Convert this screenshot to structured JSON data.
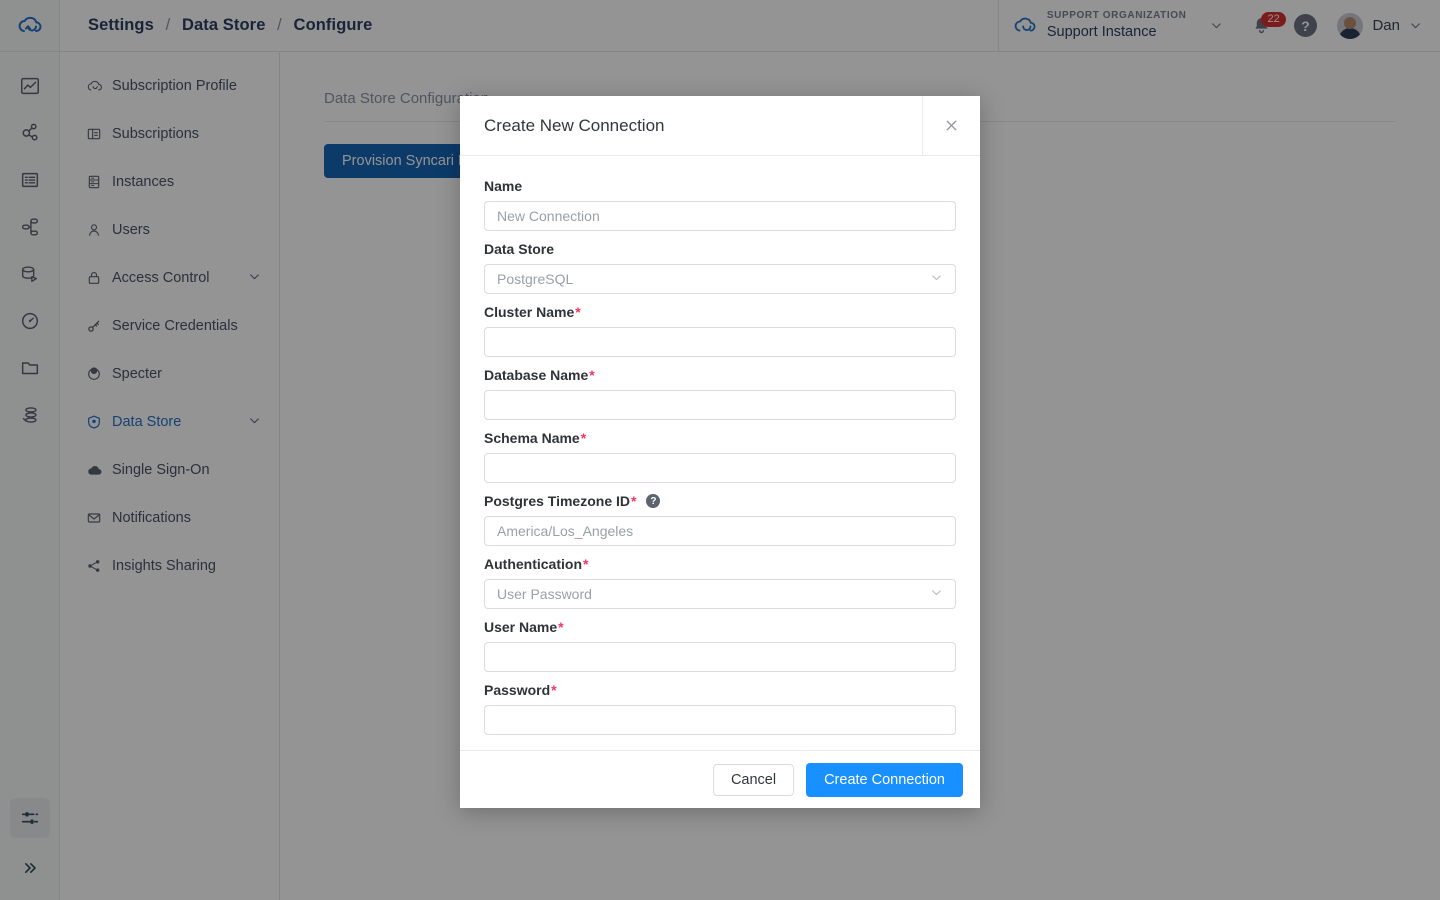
{
  "colors": {
    "brand_blue": "#2573c6",
    "primary_button": "#1890ff",
    "provision_button": "#1565b5",
    "required_asterisk": "#f5365c",
    "badge_red": "#d63031",
    "breadcrumb_text": "#2c3e63"
  },
  "topbar": {
    "logo_icon": "cloud-sync-logo",
    "breadcrumb": {
      "items": [
        "Settings",
        "Data Store",
        "Configure"
      ],
      "separator": "/"
    },
    "org": {
      "icon": "cloud-sync-icon",
      "label": "SUPPORT ORGANIZATION",
      "name": "Support Instance",
      "caret_icon": "chevron-down-icon"
    },
    "notifications": {
      "icon": "bell-icon",
      "count": "22"
    },
    "help": {
      "icon": "question-mark-icon",
      "glyph": "?"
    },
    "user": {
      "avatar_icon": "user-avatar",
      "name": "Dan",
      "caret_icon": "chevron-down-icon"
    }
  },
  "rail": {
    "icons": [
      "analytics-chart-icon",
      "nodes-graph-icon",
      "list-icon",
      "pipeline-icon",
      "database-sync-icon",
      "gauge-icon",
      "folder-icon",
      "data-stack-icon"
    ],
    "bottom": {
      "settings_icon": "sliders-settings-icon",
      "expand_icon": "chevron-double-right-icon"
    }
  },
  "sidebar": {
    "items": [
      {
        "label": "Subscription Profile",
        "icon": "cloud-icon",
        "active": false,
        "expandable": false
      },
      {
        "label": "Subscriptions",
        "icon": "card-list-icon",
        "active": false,
        "expandable": false
      },
      {
        "label": "Instances",
        "icon": "server-icon",
        "active": false,
        "expandable": false
      },
      {
        "label": "Users",
        "icon": "user-icon",
        "active": false,
        "expandable": false
      },
      {
        "label": "Access Control",
        "icon": "lock-icon",
        "active": false,
        "expandable": true
      },
      {
        "label": "Service Credentials",
        "icon": "key-icon",
        "active": false,
        "expandable": false
      },
      {
        "label": "Specter",
        "icon": "target-icon",
        "active": false,
        "expandable": false
      },
      {
        "label": "Data Store",
        "icon": "data-store-icon",
        "active": true,
        "expandable": true
      },
      {
        "label": "Single Sign-On",
        "icon": "cloud-solid-icon",
        "active": false,
        "expandable": false
      },
      {
        "label": "Notifications",
        "icon": "envelope-icon",
        "active": false,
        "expandable": false
      },
      {
        "label": "Insights Sharing",
        "icon": "share-icon",
        "active": false,
        "expandable": false
      }
    ],
    "caret_icon": "chevron-down-icon"
  },
  "main": {
    "section_title": "Data Store Configuration",
    "provision_button": "Provision Syncari Data Store"
  },
  "modal": {
    "title": "Create New Connection",
    "close_icon": "close-x-icon",
    "fields": [
      {
        "label": "Name",
        "required": false,
        "type": "text",
        "value": "",
        "placeholder": "New Connection",
        "name": "connection-name-input"
      },
      {
        "label": "Data Store",
        "required": false,
        "type": "select",
        "value": "PostgreSQL",
        "placeholder": "",
        "name": "data-store-select"
      },
      {
        "label": "Cluster Name",
        "required": true,
        "type": "text",
        "value": "",
        "placeholder": "",
        "name": "cluster-name-input"
      },
      {
        "label": "Database Name",
        "required": true,
        "type": "text",
        "value": "",
        "placeholder": "",
        "name": "database-name-input"
      },
      {
        "label": "Schema Name",
        "required": true,
        "type": "text",
        "value": "",
        "placeholder": "",
        "name": "schema-name-input"
      },
      {
        "label": "Postgres Timezone ID",
        "required": true,
        "type": "text",
        "value": "",
        "placeholder": "America/Los_Angeles",
        "help_icon": "question-mark-icon",
        "help_glyph": "?",
        "name": "postgres-timezone-id-input"
      },
      {
        "label": "Authentication",
        "required": true,
        "type": "select",
        "value": "User Password",
        "placeholder": "",
        "name": "authentication-select"
      },
      {
        "label": "User Name",
        "required": true,
        "type": "text",
        "value": "",
        "placeholder": "",
        "name": "user-name-input"
      },
      {
        "label": "Password",
        "required": true,
        "type": "label-only",
        "value": "",
        "placeholder": "",
        "name": "password-field"
      }
    ],
    "required_marker": "*",
    "footer": {
      "cancel_label": "Cancel",
      "submit_label": "Create Connection"
    },
    "select_caret_icon": "chevron-down-icon"
  }
}
